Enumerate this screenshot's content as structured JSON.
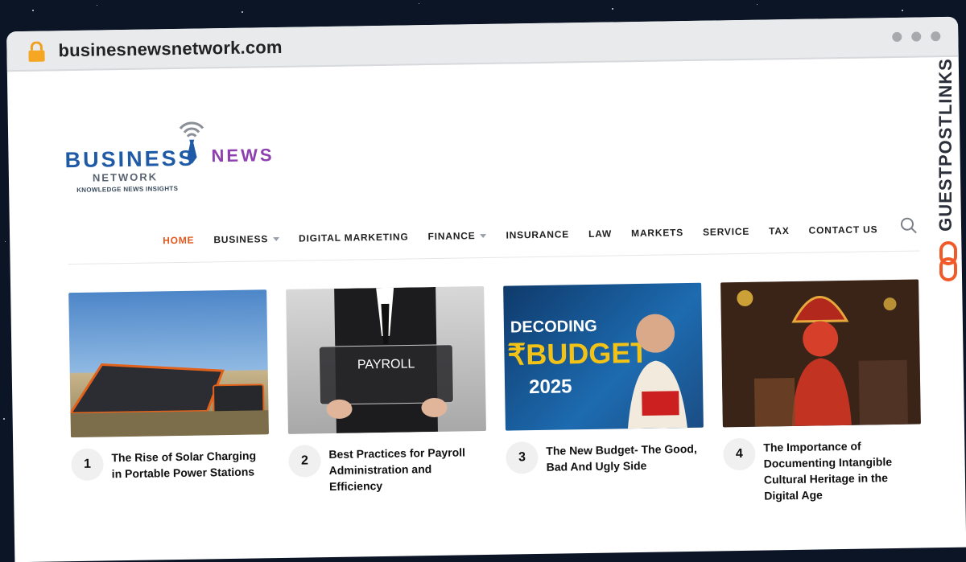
{
  "browser": {
    "url": "businesnewsnetwork.com"
  },
  "logo": {
    "primary": "BUSINESS",
    "secondary": "NEWS",
    "sub": "NETWORK",
    "tagline": "KNOWLEDGE NEWS INSIGHTS",
    "colors": {
      "primary": "#1f5aa6",
      "secondary": "#8e3fb0"
    }
  },
  "nav": {
    "items": [
      {
        "label": "HOME",
        "active": true,
        "has_dropdown": false
      },
      {
        "label": "BUSINESS",
        "active": false,
        "has_dropdown": true
      },
      {
        "label": "DIGITAL MARKETING",
        "active": false,
        "has_dropdown": false
      },
      {
        "label": "FINANCE",
        "active": false,
        "has_dropdown": true
      },
      {
        "label": "INSURANCE",
        "active": false,
        "has_dropdown": false
      },
      {
        "label": "LAW",
        "active": false,
        "has_dropdown": false
      },
      {
        "label": "MARKETS",
        "active": false,
        "has_dropdown": false
      },
      {
        "label": "SERVICE",
        "active": false,
        "has_dropdown": false
      },
      {
        "label": "TAX",
        "active": false,
        "has_dropdown": false
      },
      {
        "label": "CONTACT US",
        "active": false,
        "has_dropdown": false
      }
    ],
    "accent_color": "#e0581e",
    "search_icon": "search-icon"
  },
  "posts": [
    {
      "number": "1",
      "title": "The Rise of Solar Charging in Portable Power Stations",
      "image": "solar-panel-photo"
    },
    {
      "number": "2",
      "title": "Best Practices for Payroll Administration and Efficiency",
      "image": "payroll-photo",
      "image_text": "PAYROLL"
    },
    {
      "number": "3",
      "title": "The New Budget- The Good, Bad And Ugly Side",
      "image": "budget-photo",
      "image_text": [
        "DECODING",
        "₹BUDGET",
        "2025"
      ]
    },
    {
      "number": "4",
      "title": "The Importance of Documenting Intangible Cultural Heritage in the Digital Age",
      "image": "heritage-photo"
    }
  ],
  "side_brand": {
    "text": "GUESTPOSTLINKS",
    "accent_color": "#f05a28"
  }
}
